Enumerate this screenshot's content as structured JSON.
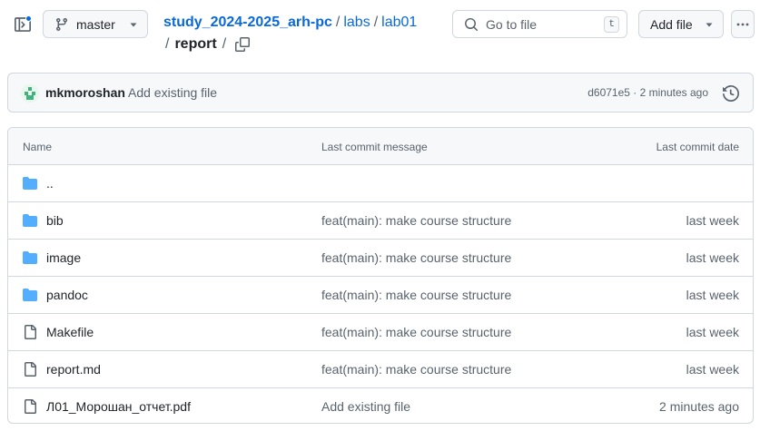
{
  "header": {
    "branch": "master",
    "breadcrumb": {
      "repo": "study_2024-2025_arh-pc",
      "sep1": "/",
      "labs": "labs",
      "sep2": "/",
      "lab": "lab01",
      "sep3": "/",
      "current": "report",
      "sep4": "/"
    },
    "goto_placeholder": "Go to file",
    "goto_shortcut": "t",
    "add_file_label": "Add file"
  },
  "commit": {
    "author": "mkmoroshan",
    "message": "Add existing file",
    "sha_time": "d6071e5 · 2 minutes ago"
  },
  "table": {
    "columns": [
      "Name",
      "Last commit message",
      "Last commit date"
    ],
    "rows": [
      {
        "type": "folder",
        "name": "..",
        "message": "",
        "date": ""
      },
      {
        "type": "folder",
        "name": "bib",
        "message": "feat(main): make course structure",
        "date": "last week"
      },
      {
        "type": "folder",
        "name": "image",
        "message": "feat(main): make course structure",
        "date": "last week"
      },
      {
        "type": "folder",
        "name": "pandoc",
        "message": "feat(main): make course structure",
        "date": "last week"
      },
      {
        "type": "file",
        "name": "Makefile",
        "message": "feat(main): make course structure",
        "date": "last week"
      },
      {
        "type": "file",
        "name": "report.md",
        "message": "feat(main): make course structure",
        "date": "last week"
      },
      {
        "type": "file",
        "name": "Л01_Морошан_отчет.pdf",
        "message": "Add existing file",
        "date": "2 minutes ago"
      }
    ]
  },
  "colors": {
    "link": "#0969da",
    "folder": "#54aeff",
    "muted": "#59636e",
    "border": "#d0d7de"
  }
}
